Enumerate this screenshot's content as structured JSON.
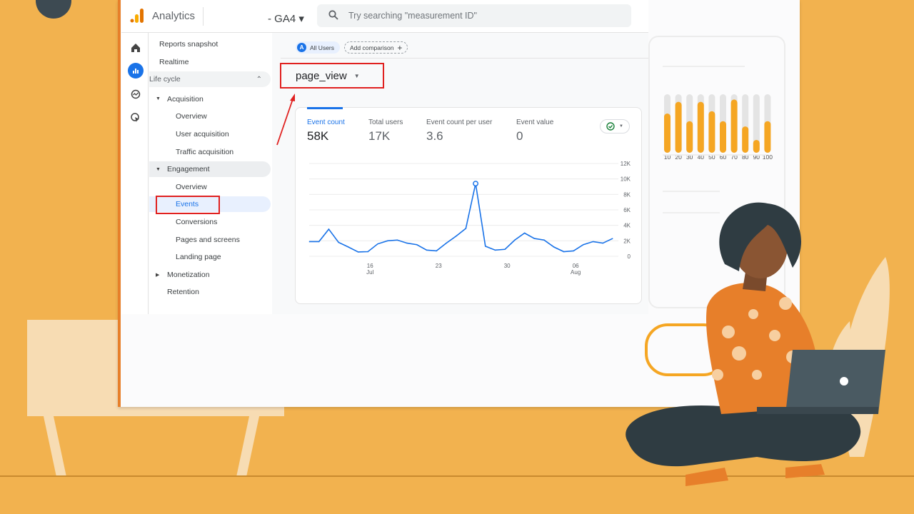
{
  "app": {
    "title": "Analytics",
    "property": "- GA4 ▾",
    "search_placeholder": "Try searching \"measurement ID\""
  },
  "rail": [
    "home-icon",
    "reports-icon",
    "explore-icon",
    "advertising-icon"
  ],
  "nav": {
    "items": [
      {
        "label": "Reports snapshot",
        "level": "l1"
      },
      {
        "label": "Realtime",
        "level": "l1"
      },
      {
        "label": "Life cycle",
        "level": "grp"
      },
      {
        "label": "Acquisition",
        "level": "l2",
        "caret": "▼"
      },
      {
        "label": "Overview",
        "level": "l3"
      },
      {
        "label": "User acquisition",
        "level": "l3"
      },
      {
        "label": "Traffic acquisition",
        "level": "l3"
      },
      {
        "label": "Engagement",
        "level": "l2",
        "caret": "▼"
      },
      {
        "label": "Overview",
        "level": "l3"
      },
      {
        "label": "Events",
        "level": "l3",
        "selected": true
      },
      {
        "label": "Conversions",
        "level": "l3"
      },
      {
        "label": "Pages and screens",
        "level": "l3"
      },
      {
        "label": "Landing page",
        "level": "l3"
      },
      {
        "label": "Monetization",
        "level": "l2",
        "caret": "▶"
      },
      {
        "label": "Retention",
        "level": "l2"
      }
    ]
  },
  "comparison": {
    "segment_letter": "A",
    "segment": "All Users",
    "add": "Add comparison"
  },
  "event_selector": {
    "value": "page_view"
  },
  "metrics": [
    {
      "label": "Event count",
      "value": "58K"
    },
    {
      "label": "Total users",
      "value": "17K"
    },
    {
      "label": "Event count per user",
      "value": "3.6"
    },
    {
      "label": "Event value",
      "value": "0"
    }
  ],
  "colors": {
    "accent": "#1a73e8",
    "highlight": "#e0201f",
    "background": "#f2b24f",
    "bar": "#f5a623"
  },
  "chart_data": [
    {
      "type": "line",
      "x_ticks": [
        "16 Jul",
        "23",
        "30",
        "06 Aug"
      ],
      "y_ticks": [
        "0",
        "2K",
        "4K",
        "6K",
        "8K",
        "10K",
        "12K"
      ],
      "ylim": [
        0,
        12000
      ],
      "grid": true,
      "x": [
        "Jul 10",
        "Jul 11",
        "Jul 12",
        "Jul 13",
        "Jul 14",
        "Jul 15",
        "Jul 16",
        "Jul 17",
        "Jul 18",
        "Jul 19",
        "Jul 20",
        "Jul 21",
        "Jul 22",
        "Jul 23",
        "Jul 24",
        "Jul 25",
        "Jul 26",
        "Jul 27",
        "Jul 28",
        "Jul 29",
        "Jul 30",
        "Jul 31",
        "Aug 1",
        "Aug 2",
        "Aug 3",
        "Aug 4",
        "Aug 5",
        "Aug 6",
        "Aug 7",
        "Aug 8",
        "Aug 9",
        "Aug 10"
      ],
      "values": [
        1900,
        1900,
        3500,
        1800,
        1200,
        560,
        600,
        1600,
        2000,
        2100,
        1700,
        1500,
        800,
        700,
        1700,
        2600,
        3600,
        9400,
        1300,
        800,
        900,
        2100,
        3000,
        2300,
        2100,
        1200,
        600,
        700,
        1500,
        1900,
        1700,
        2300
      ],
      "highlight_index": 17
    },
    {
      "type": "bar",
      "categories": [
        "10",
        "20",
        "30",
        "40",
        "50",
        "60",
        "70",
        "80",
        "90",
        "100"
      ],
      "values": [
        0.67,
        0.87,
        0.54,
        0.87,
        0.71,
        0.54,
        0.91,
        0.45,
        0.22,
        0.54
      ],
      "ylim": [
        0,
        1
      ]
    }
  ]
}
